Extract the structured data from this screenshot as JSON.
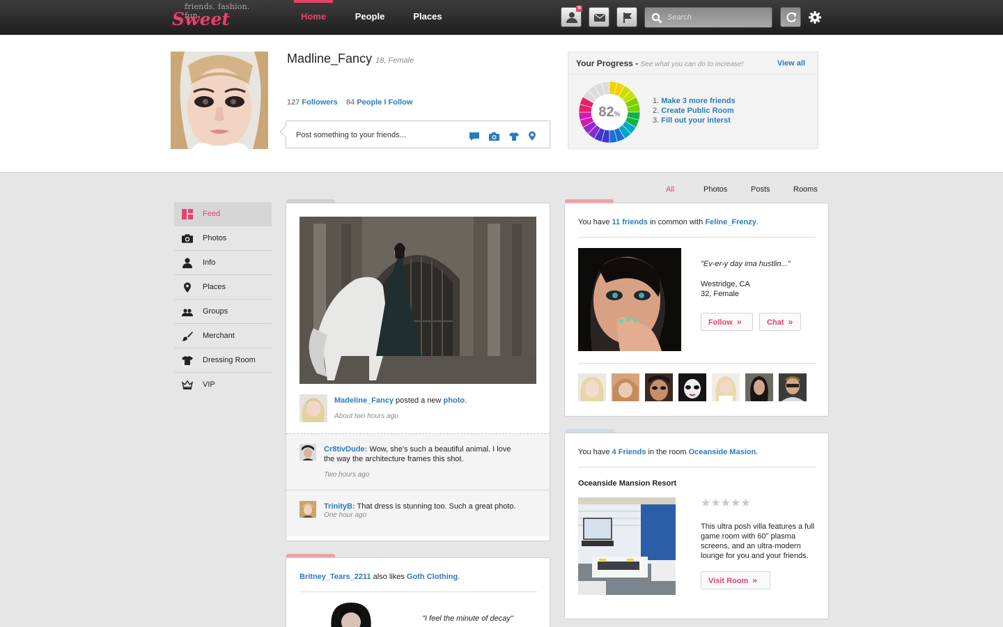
{
  "brand": {
    "tagline": "friends. fashion. fun.",
    "name": "Sweet",
    "accent": "#e8416e",
    "link": "#2b7bbf"
  },
  "nav": {
    "home": "Home",
    "people": "People",
    "places": "Places"
  },
  "toolbar": {
    "icons": [
      "profile-icon",
      "mail-icon",
      "flag-icon",
      "search-icon",
      "refresh-icon",
      "gear-icon"
    ],
    "notif_badge": "N",
    "search_placeholder": "Search"
  },
  "profile": {
    "name": "Madline_Fancy",
    "meta": "18, Female",
    "followers_count": "127",
    "followers_label": "Followers",
    "following_count": "84",
    "following_label": "People I Follow",
    "composer_placeholder": "Post something to your friends..."
  },
  "progress": {
    "title": "Your Progress -",
    "subtitle": "See what you can do to increase!",
    "view_all": "View all",
    "percent": "82",
    "percent_sign": "%",
    "value": 0.82,
    "tasks": [
      {
        "num": "1.",
        "label": "Make 3 more friends"
      },
      {
        "num": "2.",
        "label": "Create Public Room"
      },
      {
        "num": "3.",
        "label": "Fill out your interst"
      }
    ]
  },
  "sidebar": {
    "items": [
      {
        "label": "Feed",
        "icon": "feed-icon"
      },
      {
        "label": "Photos",
        "icon": "camera-icon"
      },
      {
        "label": "Info",
        "icon": "person-icon"
      },
      {
        "label": "Places",
        "icon": "map-pin-icon"
      },
      {
        "label": "Groups",
        "icon": "groups-icon"
      },
      {
        "label": "Merchant",
        "icon": "brush-icon"
      },
      {
        "label": "Dressing Room",
        "icon": "tshirt-icon"
      },
      {
        "label": "VIP",
        "icon": "crown-icon"
      }
    ]
  },
  "filters": {
    "all": "All",
    "photos": "Photos",
    "posts": "Posts",
    "rooms": "Rooms"
  },
  "feed": {
    "post": {
      "author": "Madeline_Fancy",
      "action": "posted a new",
      "object": "photo",
      "period": ".",
      "time": "About two hours ago"
    },
    "comments": [
      {
        "author": "Cr8tivDude:",
        "text_line1": "Wow, she's such a beautiful animal. I love",
        "text_line2": "the way the architecture frames this shot.",
        "time": "Two hours ago"
      },
      {
        "author": "TrinityB:",
        "text_line1": "That dress is stunning too. Such a great photo.",
        "time": "One hour ago"
      }
    ],
    "second": {
      "author": "Britney_Tears_2211",
      "action": "also likes",
      "object": "Goth Clothing",
      "period": ".",
      "quote": "\"I feel the minute of decay\""
    }
  },
  "common": {
    "prefix": "You have",
    "friends": "11 friends",
    "middle": "in common with",
    "user": "Feline_Frenzy",
    "period": ".",
    "quote": "\"Ev-er-y day ima hustlin...\"",
    "location": "Westridge, CA",
    "meta": "32, Female",
    "follow": "Follow",
    "chat": "Chat",
    "chev": "»"
  },
  "room": {
    "prefix": "You have",
    "friends": "4 Friends",
    "middle": "in the room",
    "room_link": "Oceanside Masion",
    "period": ".",
    "title": "Oceanside Mansion Resort",
    "stars": "★★★★★",
    "rating": 0,
    "desc_lines": [
      "This ultra posh villa features a full",
      "game room with 60\" plasma",
      "screens, and an ultra-modern",
      "lounge for you and your friends."
    ],
    "visit": "Visit Room",
    "chev": "»"
  }
}
